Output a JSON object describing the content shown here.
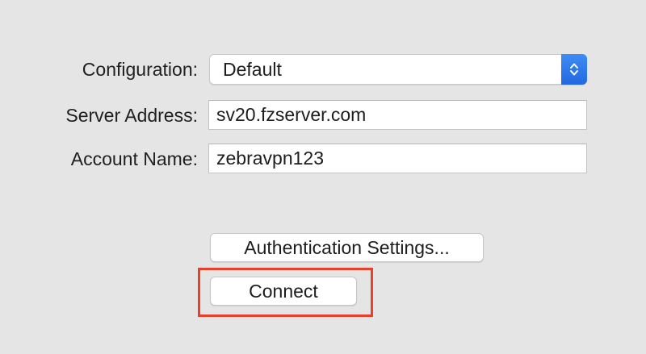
{
  "form": {
    "configuration": {
      "label": "Configuration:",
      "value": "Default"
    },
    "server_address": {
      "label": "Server Address:",
      "value": "sv20.fzserver.com"
    },
    "account_name": {
      "label": "Account Name:",
      "value": "zebravpn123"
    }
  },
  "buttons": {
    "authentication_settings": "Authentication Settings...",
    "connect": "Connect"
  },
  "icons": {
    "popup_stepper": "up-down-chevron-icon"
  },
  "colors": {
    "background": "#e5e5e5",
    "accent": "#2f7cf6",
    "highlight": "#e8402b"
  }
}
